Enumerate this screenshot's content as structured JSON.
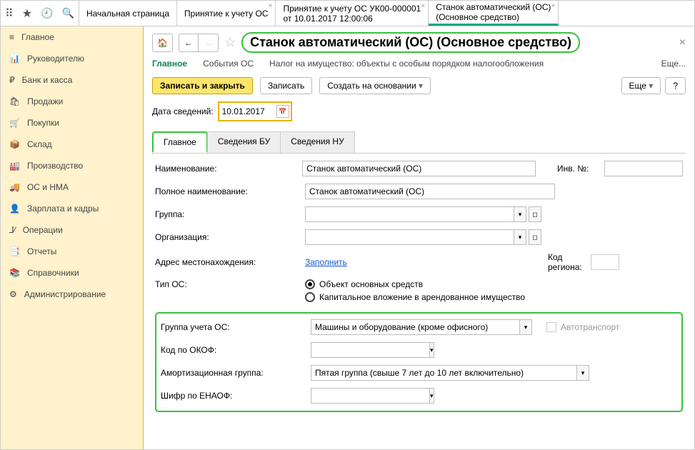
{
  "top_tabs": [
    {
      "label": "Начальная страница",
      "closable": false
    },
    {
      "label": "Принятие к учету ОС",
      "closable": true
    },
    {
      "label": "Принятие к учету ОС УК00-000001",
      "sub": "от 10.01.2017 12:00:06",
      "closable": true
    },
    {
      "label": "Станок автоматический (ОС)",
      "sub": "(Основное средство)",
      "closable": true,
      "active": true
    }
  ],
  "sidebar": [
    "Главное",
    "Руководителю",
    "Банк и касса",
    "Продажи",
    "Покупки",
    "Склад",
    "Производство",
    "ОС и НМА",
    "Зарплата и кадры",
    "Операции",
    "Отчеты",
    "Справочники",
    "Администрирование"
  ],
  "header": {
    "title": "Станок автоматический (ОС) (Основное средство)"
  },
  "menu": {
    "left": [
      "Главное",
      "События ОС",
      "Налог на имущество: объекты с особым порядком налогообложения"
    ],
    "more": "Еще..."
  },
  "actions": {
    "write_close": "Записать и закрыть",
    "write": "Записать",
    "create_based": "Создать на основании",
    "more": "Еще",
    "help": "?"
  },
  "date_row": {
    "label": "Дата сведений:",
    "value": "10.01.2017"
  },
  "sub_tabs": [
    "Главное",
    "Сведения БУ",
    "Сведения НУ"
  ],
  "fields": {
    "name": {
      "label": "Наименование:",
      "value": "Станок автоматический (ОС)"
    },
    "inv": {
      "label": "Инв. №:",
      "value": ""
    },
    "full_name": {
      "label": "Полное наименование:",
      "value": "Станок автоматический (ОС)"
    },
    "group": {
      "label": "Группа:",
      "value": ""
    },
    "org": {
      "label": "Организация:",
      "value": ""
    },
    "location": {
      "label": "Адрес местонахождения:",
      "link": "Заполнить",
      "region_label": "Код региона:",
      "region_value": ""
    },
    "type": {
      "label": "Тип ОС:",
      "opt1": "Объект основных средств",
      "opt2": "Капитальное вложение в арендованное имущество"
    },
    "acc_group": {
      "label": "Группа учета ОС:",
      "value": "Машины и оборудование (кроме офисного)",
      "auto": "Автотранспорт"
    },
    "okof": {
      "label": "Код по ОКОФ:",
      "value": ""
    },
    "amort": {
      "label": "Амортизационная группа:",
      "value": "Пятая группа (свыше 7 лет до 10 лет включительно)"
    },
    "enaof": {
      "label": "Шифр по ЕНАОФ:",
      "value": ""
    }
  }
}
